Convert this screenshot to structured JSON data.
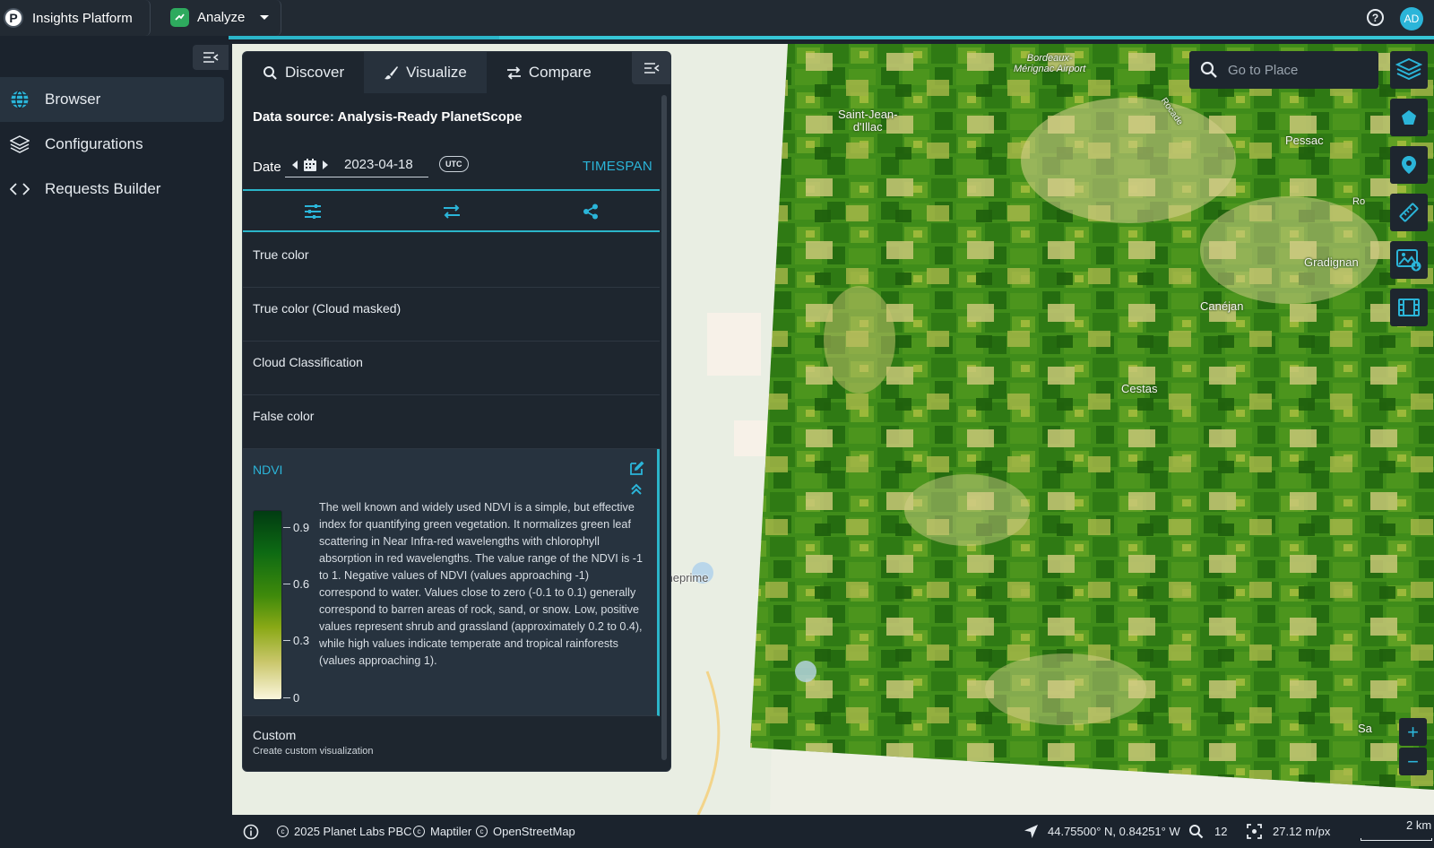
{
  "topbar": {
    "brand_letter": "P",
    "brand_name": "Insights Platform",
    "app_name": "Analyze",
    "help_symbol": "?",
    "avatar_initials": "AD"
  },
  "leftnav": {
    "items": [
      {
        "label": "Browser",
        "icon": "globe-icon",
        "active": true
      },
      {
        "label": "Configurations",
        "icon": "layers-icon",
        "active": false
      },
      {
        "label": "Requests Builder",
        "icon": "code-icon",
        "active": false
      }
    ]
  },
  "panel": {
    "tabs": [
      {
        "label": "Discover",
        "icon": "search-icon"
      },
      {
        "label": "Visualize",
        "icon": "brush-icon",
        "active": true
      },
      {
        "label": "Compare",
        "icon": "swap-icon"
      }
    ],
    "datasource_label": "Data source:",
    "datasource_value": "Analysis-Ready PlanetScope",
    "date_label": "Date",
    "date_value": "2023-04-18",
    "utc": "UTC",
    "timespan": "TIMESPAN",
    "layers": [
      "True color",
      "True color (Cloud masked)",
      "Cloud Classification",
      "False color"
    ],
    "ndvi": {
      "name": "NDVI",
      "ticks": [
        "0.9",
        "0.6",
        "0.3",
        "0"
      ],
      "description": "The well known and widely used NDVI is a simple, but effective index for quantifying green vegetation. It normalizes green leaf scattering in Near Infra-red wavelengths with chlorophyll absorption in red wavelengths. The value range of the NDVI is -1 to 1. Negative values of NDVI (values approaching -1) correspond to water. Values close to zero (-0.1 to 0.1) generally correspond to barren areas of rock, sand, or snow. Low, positive values represent shrub and grassland (approximately 0.2 to 0.4), while high values indicate temperate and tropical rainforests (values approaching 1)."
    },
    "custom": {
      "title": "Custom",
      "subtitle": "Create custom visualization"
    }
  },
  "search": {
    "placeholder": "Go to Place"
  },
  "map_labels": {
    "bordeaux": "Bordeaux-",
    "bordeaux2": "Mérignac Airport",
    "saint_jean": "Saint-Jean-",
    "saint_jean2": "d'Illac",
    "pessac": "Pessac",
    "gradignan": "Gradignan",
    "canejan": "Canéjan",
    "cestas": "Cestas",
    "rocade": "Rocade",
    "cheprime": "cheprime",
    "ro": "Ro",
    "sa": "Sa",
    "en": "en"
  },
  "zoom": {
    "in": "+",
    "out": "−"
  },
  "statusbar": {
    "attribution": [
      "2025 Planet Labs PBC",
      "Maptiler",
      "OpenStreetMap"
    ],
    "coords": "44.75500° N, 0.84251° W",
    "zoom_level": "12",
    "resolution": "27.12 m/px",
    "scale": "2 km"
  },
  "colors": {
    "accent": "#2bb5d9",
    "panel_bg": "#1e262f",
    "app_bg": "#1b232d"
  }
}
